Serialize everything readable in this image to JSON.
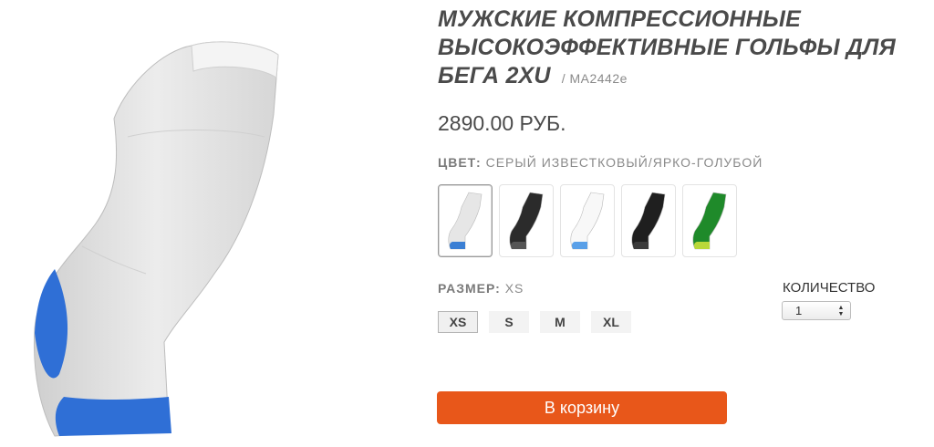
{
  "product": {
    "title": "МУЖСКИЕ КОМПРЕССИОННЫЕ ВЫСОКОЭФФЕКТИВНЫЕ ГОЛЬФЫ ДЛЯ БЕГА 2XU",
    "sku": "/  MA2442e",
    "price": "2890.00 РУБ."
  },
  "color": {
    "label": "ЦВЕТ:",
    "value": "СЕРЫЙ ИЗВЕСТКОВЫЙ/ЯРКО-ГОЛУБОЙ",
    "swatches": [
      {
        "icon": "sock-gray-blue-icon",
        "body": "#e6e6e6",
        "accent": "#3b7fd4",
        "selected": true
      },
      {
        "icon": "sock-black-gray-icon",
        "body": "#2b2b2b",
        "accent": "#555555",
        "selected": false
      },
      {
        "icon": "sock-white-blue-icon",
        "body": "#f8f8f8",
        "accent": "#5aa0e8",
        "selected": false
      },
      {
        "icon": "sock-black-icon",
        "body": "#1f1f1f",
        "accent": "#3a3a3a",
        "selected": false
      },
      {
        "icon": "sock-green-icon",
        "body": "#1f8a2a",
        "accent": "#b9d83a",
        "selected": false
      }
    ]
  },
  "size": {
    "label": "РАЗМЕР:",
    "value": "XS",
    "options": [
      "XS",
      "S",
      "M",
      "XL"
    ],
    "selected": "XS"
  },
  "quantity": {
    "label": "КОЛИЧЕСТВО",
    "value": "1"
  },
  "cart": {
    "label": "В корзину",
    "color": "#e8571a"
  }
}
